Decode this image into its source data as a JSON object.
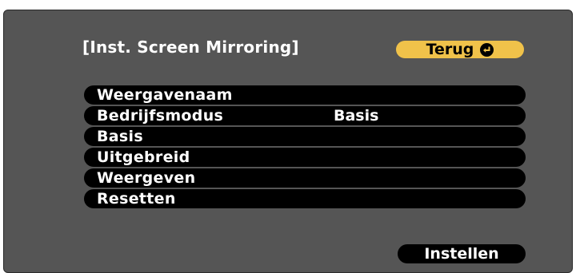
{
  "screen": {
    "title": "[Inst. Screen Mirroring]",
    "background_color": "#555555"
  },
  "back_button": {
    "label": "Terug",
    "icon": "enter-icon",
    "color": "#f0c24a"
  },
  "menu": {
    "items": [
      {
        "label": "Weergavenaam",
        "value": ""
      },
      {
        "label": "Bedrijfsmodus",
        "value": "Basis"
      },
      {
        "label": "Basis",
        "value": ""
      },
      {
        "label": "Uitgebreid",
        "value": ""
      },
      {
        "label": "Weergeven",
        "value": ""
      },
      {
        "label": "Resetten",
        "value": ""
      }
    ]
  },
  "set_button": {
    "label": "Instellen"
  }
}
